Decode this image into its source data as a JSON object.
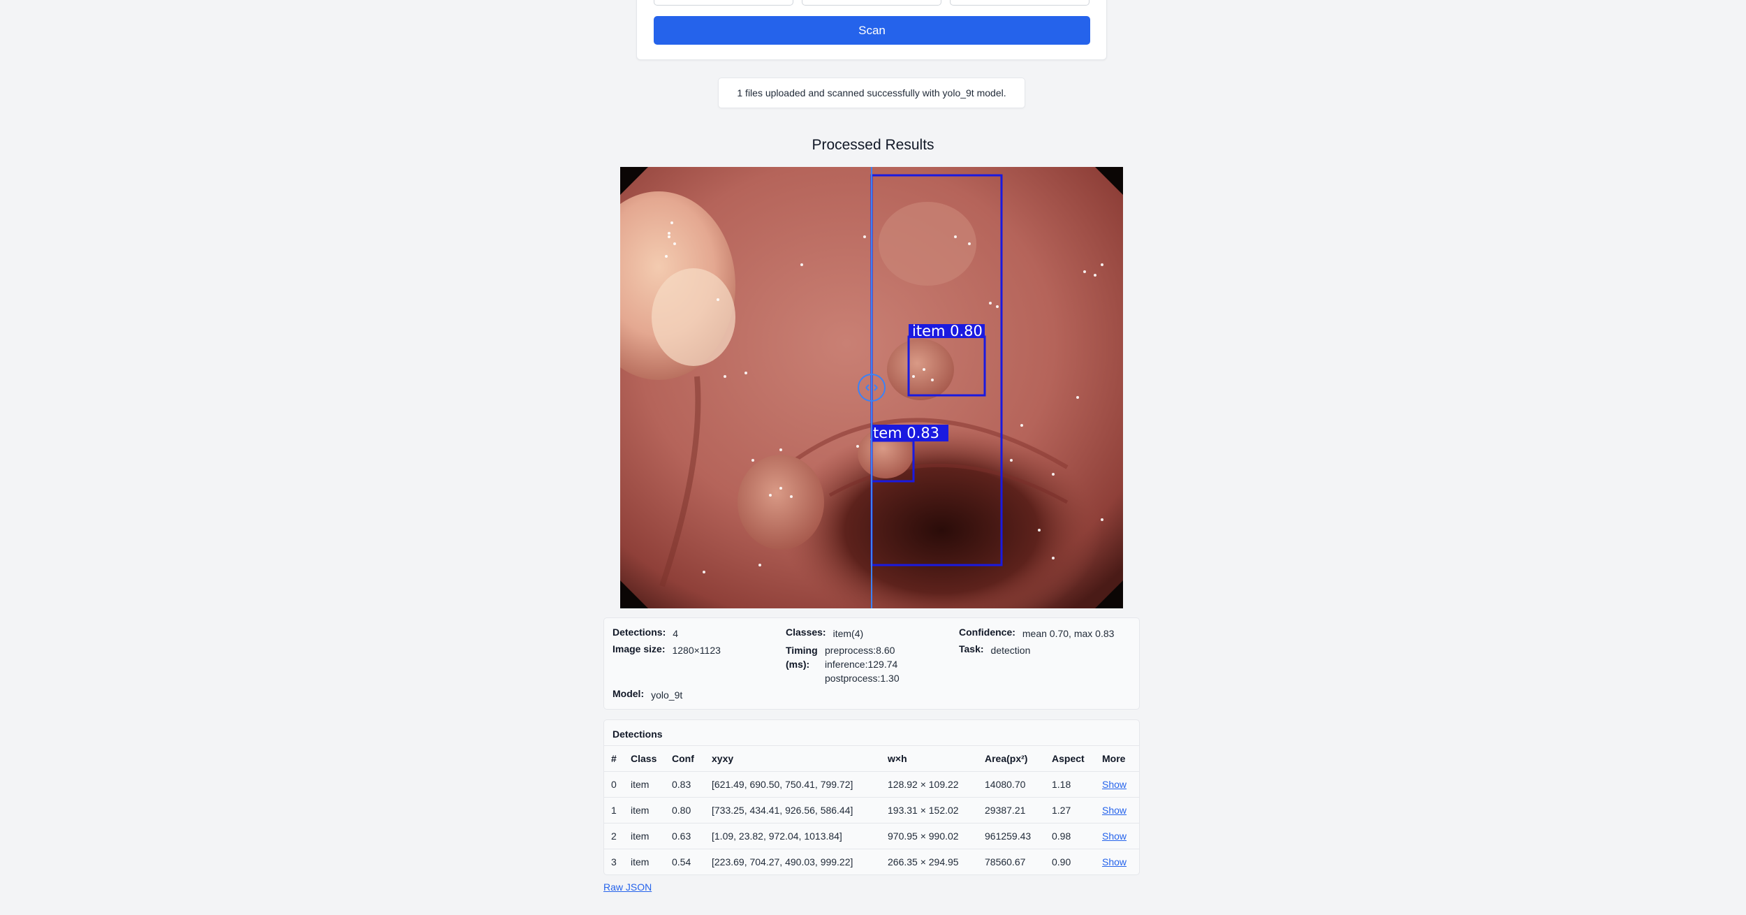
{
  "upload": {
    "scan_label": "Scan"
  },
  "status_message": "1 files uploaded and scanned successfully with yolo_9t model.",
  "results_title": "Processed Results",
  "image_overlay": {
    "labels": [
      "item 0.80",
      "tem 0.83"
    ],
    "box_color": "#1a1ae0",
    "guide_color": "#3b82f6"
  },
  "summary": {
    "detections_label": "Detections:",
    "detections_value": "4",
    "classes_label": "Classes:",
    "classes_value": "item(4)",
    "confidence_label": "Confidence:",
    "confidence_value": "mean 0.70, max 0.83",
    "image_size_label": "Image size:",
    "image_size_value": "1280×1123",
    "timing_label": "Timing (ms):",
    "timing_preprocess": "preprocess:8.60",
    "timing_inference": "inference:129.74",
    "timing_postprocess": "postprocess:1.30",
    "task_label": "Task:",
    "task_value": "detection",
    "model_label": "Model:",
    "model_value": "yolo_9t"
  },
  "detections": {
    "heading": "Detections",
    "columns": [
      "#",
      "Class",
      "Conf",
      "xyxy",
      "w×h",
      "Area(px²)",
      "Aspect",
      "More"
    ],
    "rows": [
      [
        "0",
        "item",
        "0.83",
        "[621.49, 690.50, 750.41, 799.72]",
        "128.92 × 109.22",
        "14080.70",
        "1.18",
        "Show"
      ],
      [
        "1",
        "item",
        "0.80",
        "[733.25, 434.41, 926.56, 586.44]",
        "193.31 × 152.02",
        "29387.21",
        "1.27",
        "Show"
      ],
      [
        "2",
        "item",
        "0.63",
        "[1.09, 23.82, 972.04, 1013.84]",
        "970.95 × 990.02",
        "961259.43",
        "0.98",
        "Show"
      ],
      [
        "3",
        "item",
        "0.54",
        "[223.69, 704.27, 490.03, 999.22]",
        "266.35 × 294.95",
        "78560.67",
        "0.90",
        "Show"
      ]
    ]
  },
  "raw_json_label": "Raw JSON"
}
